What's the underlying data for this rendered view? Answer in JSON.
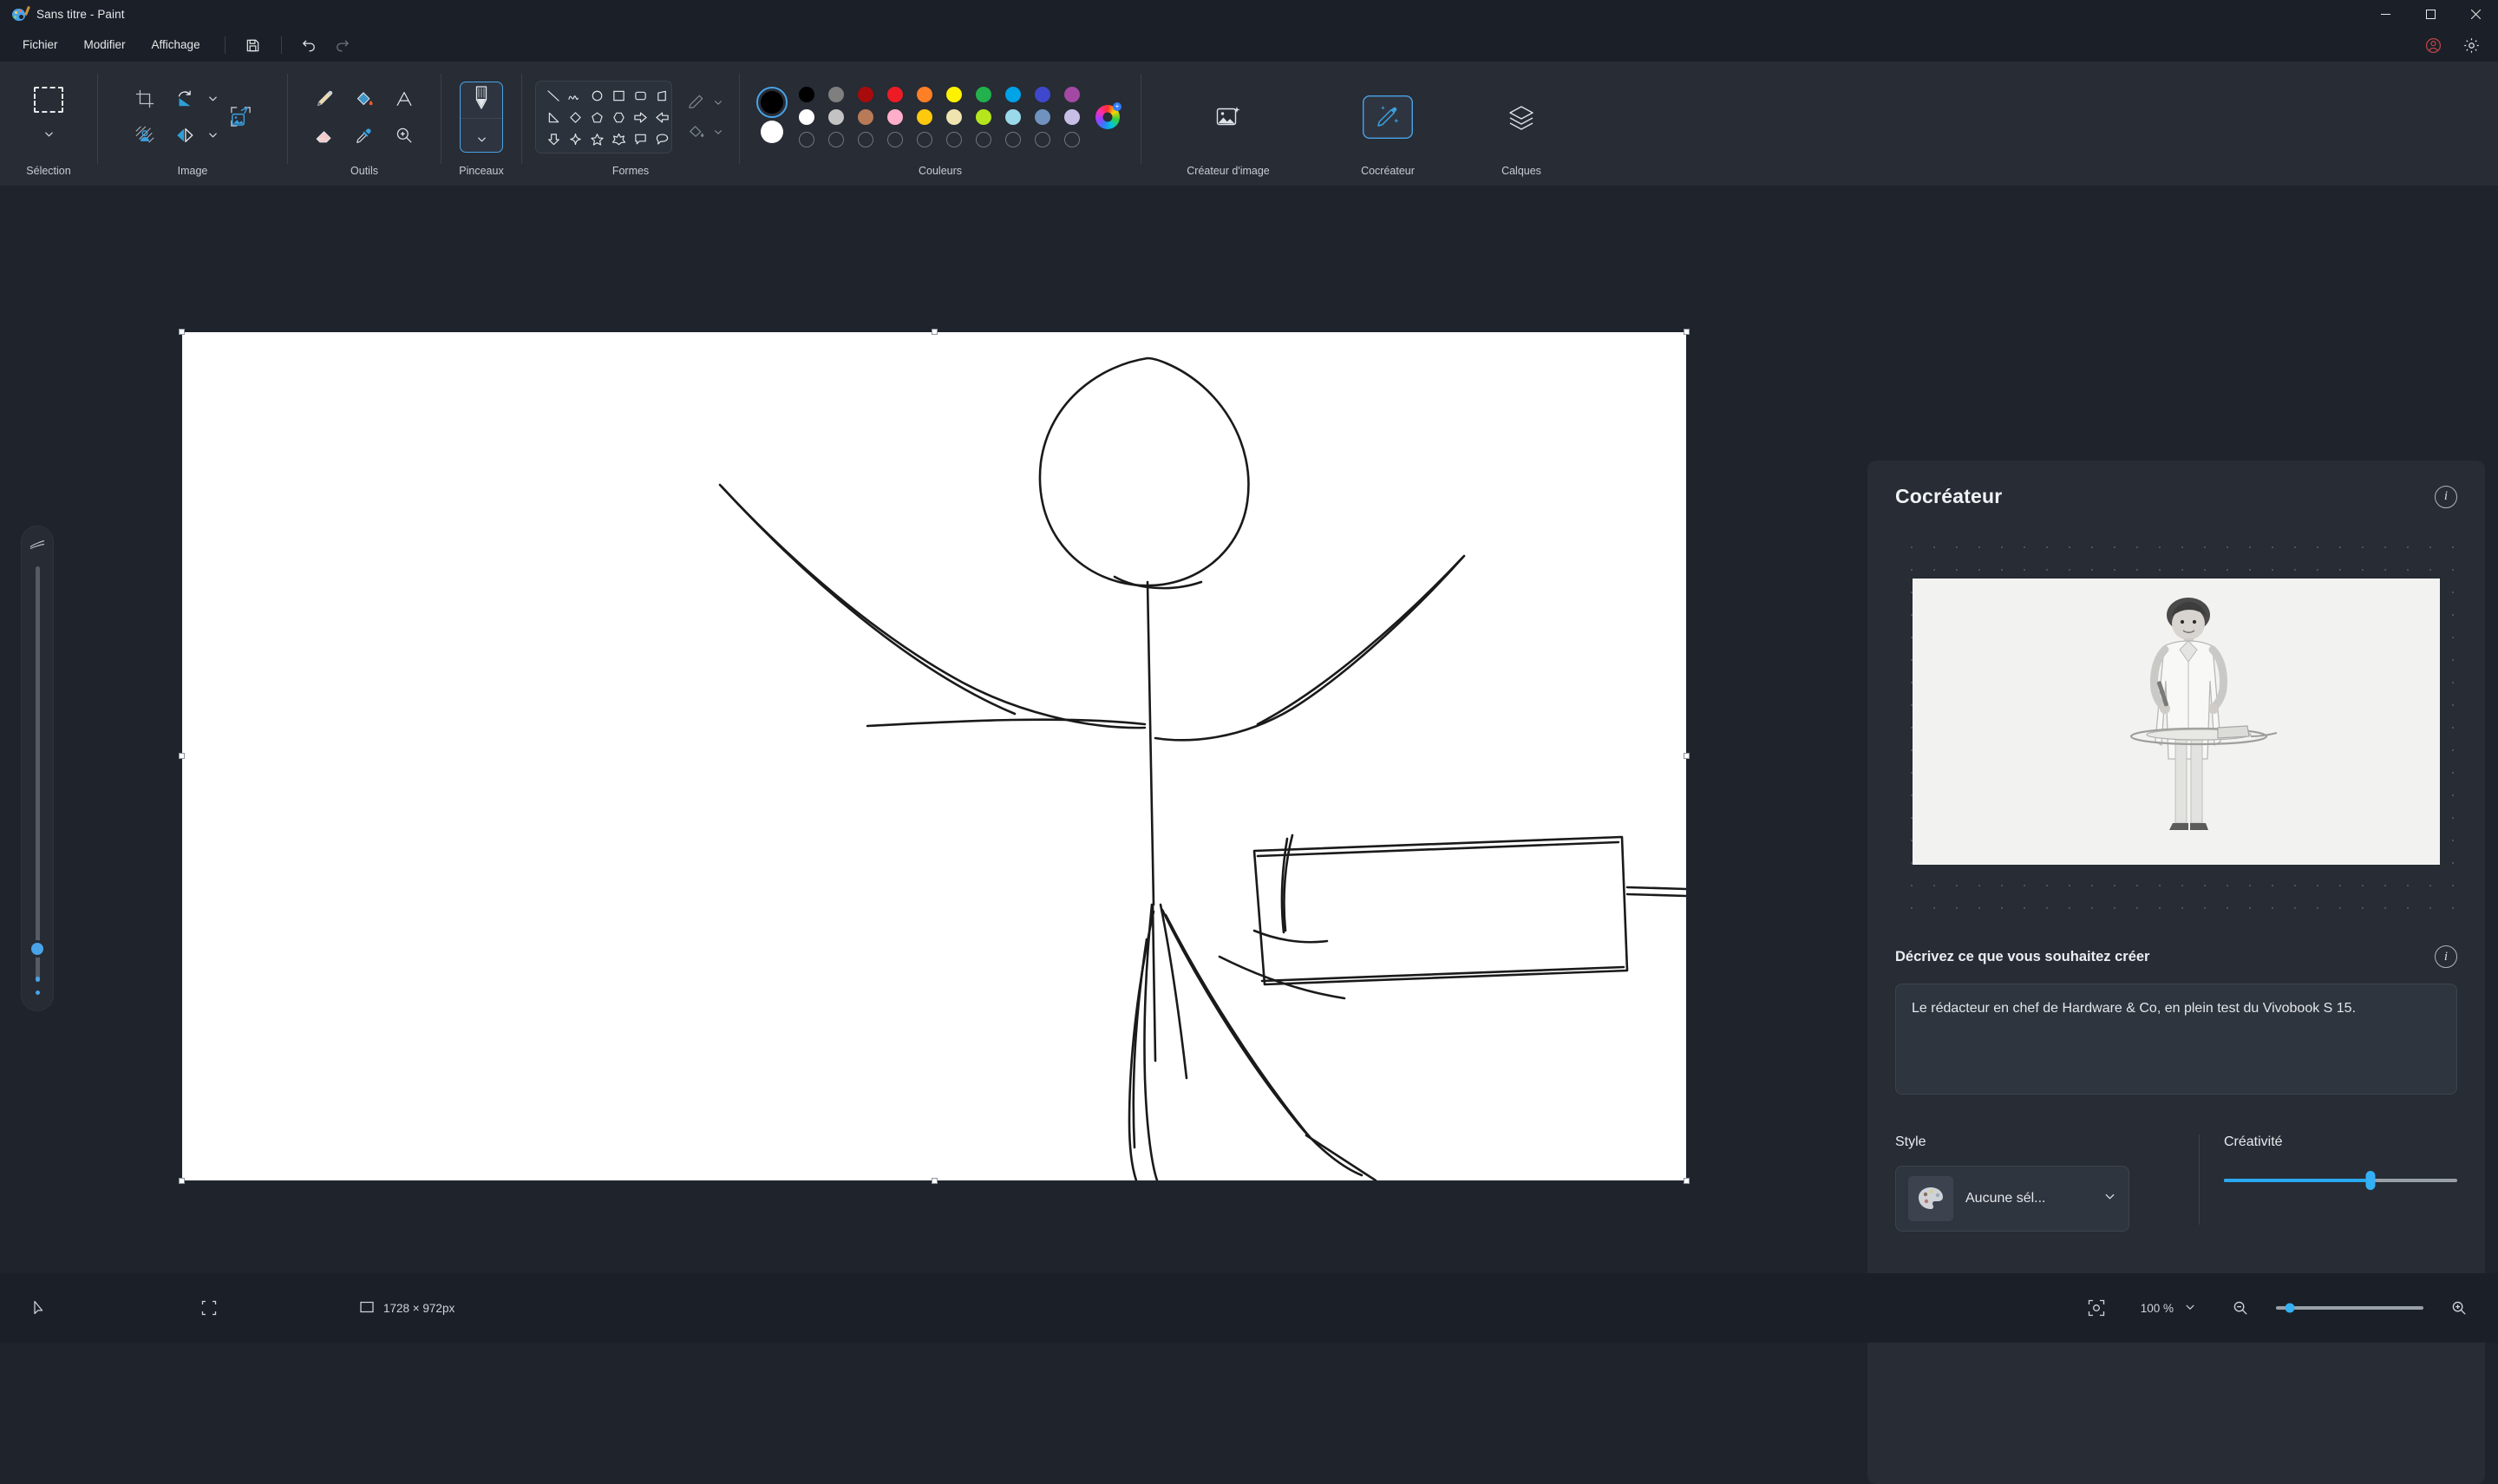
{
  "window": {
    "title": "Sans titre - Paint",
    "app_icon": "paint-palette-icon",
    "minimize": "─",
    "maximize": "☐",
    "close": "✕"
  },
  "menubar": {
    "items": [
      {
        "label": "Fichier"
      },
      {
        "label": "Modifier"
      },
      {
        "label": "Affichage"
      }
    ],
    "quick_actions": [
      {
        "name": "save-button",
        "icon": "save-icon"
      },
      {
        "name": "undo-button",
        "icon": "undo-icon"
      },
      {
        "name": "redo-button",
        "icon": "redo-icon"
      }
    ],
    "right_actions": [
      {
        "name": "account-button",
        "icon": "account-icon"
      },
      {
        "name": "settings-button",
        "icon": "gear-icon"
      }
    ]
  },
  "ribbon": {
    "groups": [
      {
        "label": "Sélection"
      },
      {
        "label": "Image"
      },
      {
        "label": "Outils"
      },
      {
        "label": "Pinceaux"
      },
      {
        "label": "Formes"
      },
      {
        "label": "Couleurs"
      }
    ],
    "image_tools": [
      {
        "name": "crop-icon"
      },
      {
        "name": "rotate-icon"
      },
      {
        "name": "remove-background-icon"
      },
      {
        "name": "flip-icon"
      },
      {
        "name": "resize-icon"
      }
    ],
    "tools": [
      {
        "name": "pencil-icon"
      },
      {
        "name": "fill-icon"
      },
      {
        "name": "text-icon"
      },
      {
        "name": "eraser-icon"
      },
      {
        "name": "eyedropper-icon"
      },
      {
        "name": "magnifier-icon"
      }
    ],
    "creator_buttons": [
      {
        "label": "Créateur d'image",
        "icon": "image-creator-icon"
      },
      {
        "label": "Cocréateur",
        "icon": "cocreator-icon"
      },
      {
        "label": "Calques",
        "icon": "layers-icon"
      }
    ],
    "shapes": [
      "line",
      "curve",
      "circle",
      "square",
      "rounded-rect",
      "right-triangle",
      "triangle",
      "diamond",
      "pentagon",
      "hexagon",
      "arrow-right",
      "arrow-left",
      "arrow-down",
      "four-point-star",
      "five-point-star",
      "six-point-star",
      "callout-rect",
      "callout-round",
      "wave",
      "ribbon"
    ]
  },
  "colors": {
    "label": "Couleurs",
    "primary": "#000000",
    "secondary": "#ffffff",
    "row1": [
      "#000000",
      "#7f7f7f",
      "#a80b0b",
      "#ed1c24",
      "#ff7f27",
      "#fff200",
      "#22b14c",
      "#00a2e8",
      "#3f48cc",
      "#a349a4"
    ],
    "row2": [
      "#ffffff",
      "#c3c3c3",
      "#b97a57",
      "#ffaec9",
      "#ffc90e",
      "#efe4b0",
      "#b5e61d",
      "#99d9ea",
      "#7092be",
      "#c8bfe7"
    ],
    "row3_empty": 10,
    "wheel": "color-wheel-icon"
  },
  "canvas": {
    "drawing": "stick-figure-sketch",
    "background": "#ffffff"
  },
  "left_slider": {
    "icon": "brush-size-icon",
    "value": 8
  },
  "cocreator": {
    "title": "Cocréateur",
    "info_icon": "info-icon",
    "preview_alt": "ai-generated-preview",
    "prompt_label": "Décrivez ce que vous souhaitez créer",
    "prompt_info_icon": "info-icon",
    "prompt_value": "Le rédacteur en chef de Hardware & Co, en plein test du Vivobook S 15.",
    "style_label": "Style",
    "style_value": "Aucune sél...",
    "style_thumb_icon": "palette-icon",
    "style_chevron": "chevron-down-icon",
    "creativity_label": "Créativité",
    "creativity_value": 63
  },
  "statusbar": {
    "cursor_icon": "cursor-icon",
    "selection_icon": "selection-size-icon",
    "dimensions_icon": "image-size-icon",
    "dimensions": "1728 × 972px",
    "fit_icon": "fit-to-window-icon",
    "zoom_level": "100 %",
    "zoom_chevron": "chevron-down-icon",
    "zoom_out_icon": "zoom-out-icon",
    "zoom_in_icon": "zoom-in-icon"
  }
}
